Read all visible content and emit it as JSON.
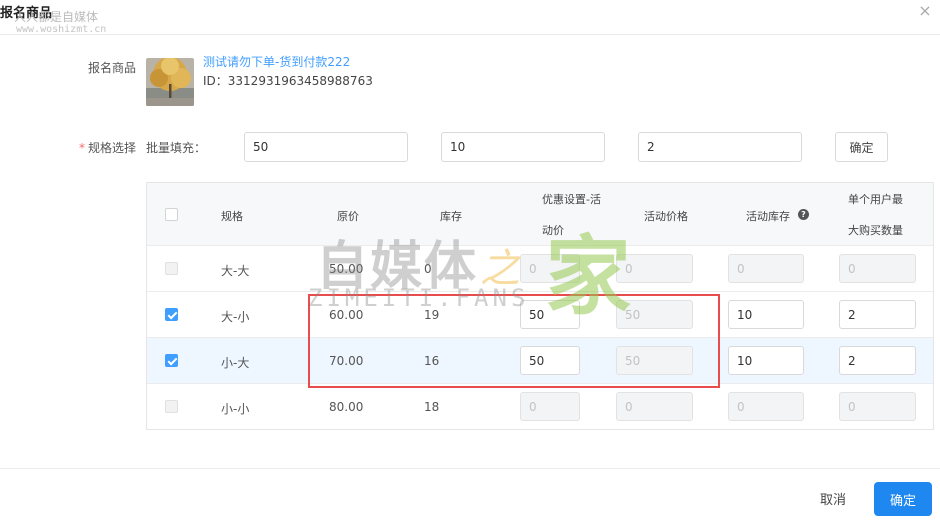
{
  "dialog": {
    "title": "报名商品",
    "watermark_text": "人人都是自媒体",
    "watermark_url": "www.woshizmt.cn",
    "close_glyph": "×"
  },
  "product": {
    "label": "报名商品",
    "name": "测试请勿下单-货到付款222",
    "id_text": "ID：3312931963458988763"
  },
  "spec": {
    "required_mark": "*",
    "label": "规格选择",
    "batch_label": "批量填充：",
    "batch_values": [
      "50",
      "10",
      "2"
    ],
    "confirm_label": "确定"
  },
  "table": {
    "headers": {
      "spec": "规格",
      "orig_price": "原价",
      "stock": "库存",
      "discount_line1": "优惠设置-活",
      "discount_line2": "动价",
      "act_price": "活动价格",
      "act_stock": "活动库存",
      "limit_line1": "单个用户最",
      "limit_line2": "大购买数量"
    },
    "help_glyph": "?",
    "rows": [
      {
        "spec": "大-大",
        "orig_price": "50.00",
        "stock": "0",
        "discount": "0",
        "act_price": "0",
        "act_stock": "0",
        "limit": "0",
        "checked": false,
        "disabled": true
      },
      {
        "spec": "大-小",
        "orig_price": "60.00",
        "stock": "19",
        "discount": "50",
        "act_price": "50",
        "act_stock": "10",
        "limit": "2",
        "checked": true,
        "disabled": false
      },
      {
        "spec": "小-大",
        "orig_price": "70.00",
        "stock": "16",
        "discount": "50",
        "act_price": "50",
        "act_stock": "10",
        "limit": "2",
        "checked": true,
        "disabled": false
      },
      {
        "spec": "小-小",
        "orig_price": "80.00",
        "stock": "18",
        "discount": "0",
        "act_price": "0",
        "act_stock": "0",
        "limit": "0",
        "checked": false,
        "disabled": true
      }
    ]
  },
  "overlay_watermark": {
    "main": "自媒体",
    "zhi": "之",
    "jia": "家",
    "sub": "ZIMEITI.FANS"
  },
  "footer": {
    "cancel_label": "取消",
    "ok_label": "确定"
  },
  "colors": {
    "primary": "#1e88f0",
    "link": "#409eff",
    "highlight_box": "#e84c4c",
    "row_highlight": "#eef6ff"
  }
}
